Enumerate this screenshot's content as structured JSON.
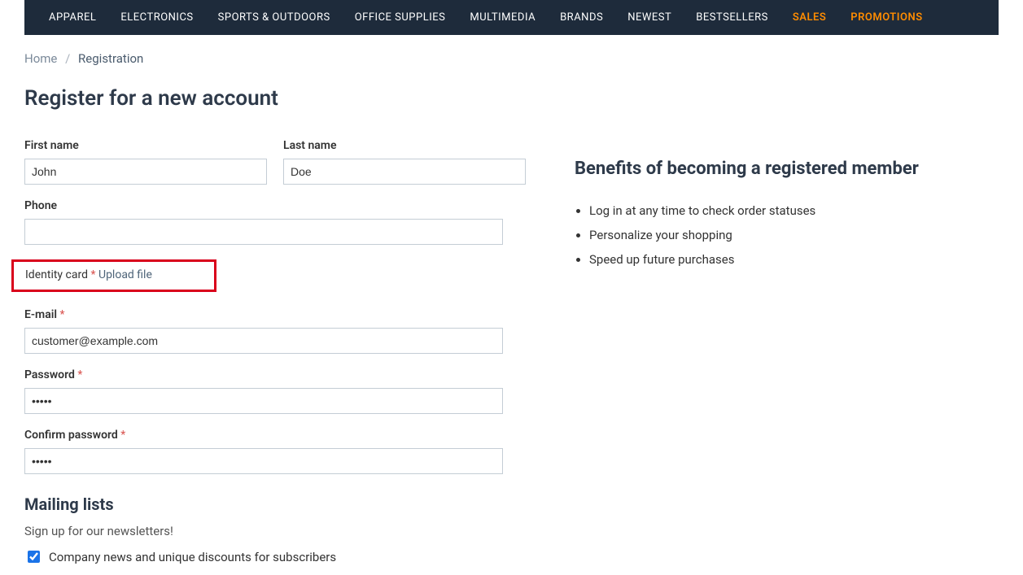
{
  "nav": {
    "items": [
      {
        "label": "APPAREL",
        "highlight": false
      },
      {
        "label": "ELECTRONICS",
        "highlight": false
      },
      {
        "label": "SPORTS & OUTDOORS",
        "highlight": false
      },
      {
        "label": "OFFICE SUPPLIES",
        "highlight": false
      },
      {
        "label": "MULTIMEDIA",
        "highlight": false
      },
      {
        "label": "BRANDS",
        "highlight": false
      },
      {
        "label": "NEWEST",
        "highlight": false
      },
      {
        "label": "BESTSELLERS",
        "highlight": false
      },
      {
        "label": "SALES",
        "highlight": true
      },
      {
        "label": "PROMOTIONS",
        "highlight": true
      }
    ]
  },
  "breadcrumb": {
    "home": "Home",
    "sep": "/",
    "current": "Registration"
  },
  "title": "Register for a new account",
  "form": {
    "first_name": {
      "label": "First name",
      "value": "John"
    },
    "last_name": {
      "label": "Last name",
      "value": "Doe"
    },
    "phone": {
      "label": "Phone",
      "value": ""
    },
    "identity": {
      "label": "Identity card",
      "upload": "Upload file"
    },
    "email": {
      "label": "E-mail",
      "value": "customer@example.com"
    },
    "password": {
      "label": "Password",
      "value": "•••••"
    },
    "confirm": {
      "label": "Confirm password",
      "value": "•••••"
    },
    "asterisk": "*"
  },
  "mailing": {
    "heading": "Mailing lists",
    "subtext": "Sign up for our newsletters!",
    "option": "Company news and unique discounts for subscribers"
  },
  "benefits": {
    "heading": "Benefits of becoming a registered member",
    "items": [
      "Log in at any time to check order statuses",
      "Personalize your shopping",
      "Speed up future purchases"
    ]
  }
}
